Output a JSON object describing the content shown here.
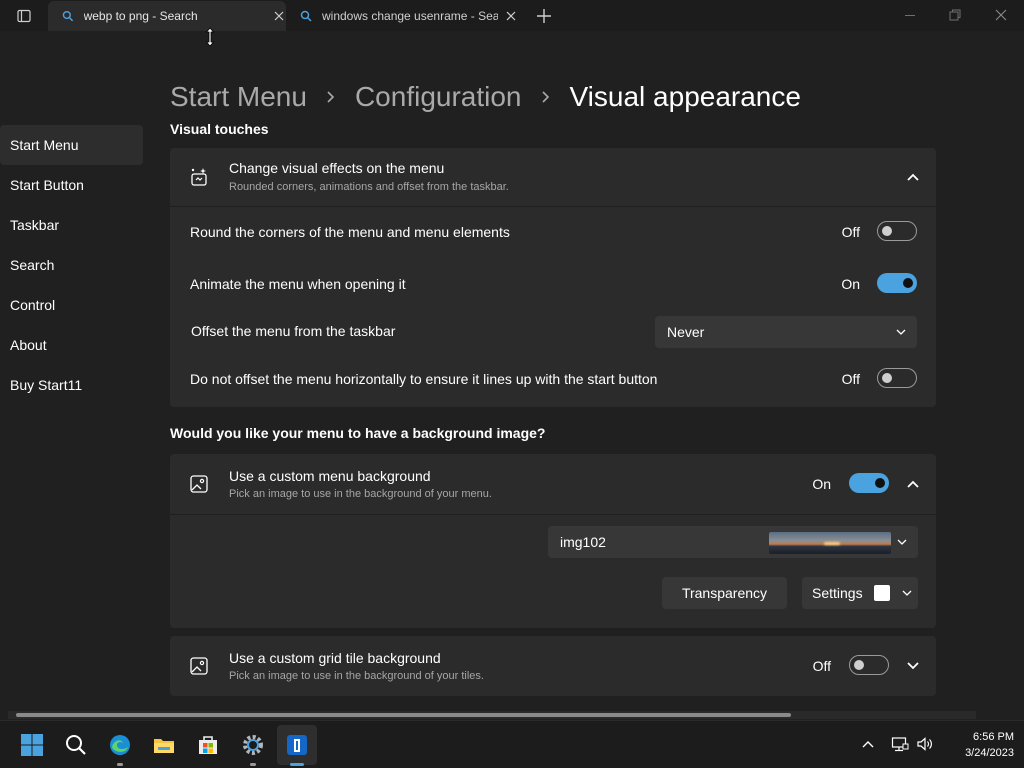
{
  "browser": {
    "tabs": [
      {
        "title": "webp to png - Search",
        "active": true
      },
      {
        "title": "windows change usenrame - Search",
        "active": false
      }
    ]
  },
  "breadcrumb": {
    "items": [
      "Start Menu",
      "Configuration",
      "Visual appearance"
    ]
  },
  "sidebar": {
    "items": [
      {
        "label": "Start Menu",
        "selected": true
      },
      {
        "label": "Start Button"
      },
      {
        "label": "Taskbar"
      },
      {
        "label": "Search"
      },
      {
        "label": "Control"
      },
      {
        "label": "About"
      },
      {
        "label": "Buy Start11"
      }
    ]
  },
  "sections": {
    "visual_touches": "Visual touches",
    "background_question": "Would you like your menu to have a background image?"
  },
  "visual_card": {
    "title": "Change visual effects on the menu",
    "subtitle": "Rounded corners, animations and offset from the taskbar.",
    "rows": [
      {
        "label": "Round the corners of the menu and menu elements",
        "state": "Off"
      },
      {
        "label": "Animate the menu when opening it",
        "state": "On"
      },
      {
        "label": "Offset the menu from the taskbar",
        "dropdown": "Never"
      },
      {
        "label": "Do not offset the menu horizontally to ensure it lines up with the start button",
        "state": "Off"
      }
    ]
  },
  "menu_bg_card": {
    "title": "Use a custom menu background",
    "subtitle": "Pick an image to use in the background of your menu.",
    "state": "On",
    "image_name": "img102",
    "transparency_label": "Transparency",
    "settings_label": "Settings"
  },
  "grid_bg_card": {
    "title": "Use a custom grid tile background",
    "subtitle": "Pick an image to use in the background of your tiles.",
    "state": "Off"
  },
  "taskbar": {
    "time": "6:56 PM",
    "date": "3/24/2023"
  },
  "colors": {
    "accent": "#4aa3df",
    "background": "#202020",
    "card": "#2b2b2b"
  }
}
